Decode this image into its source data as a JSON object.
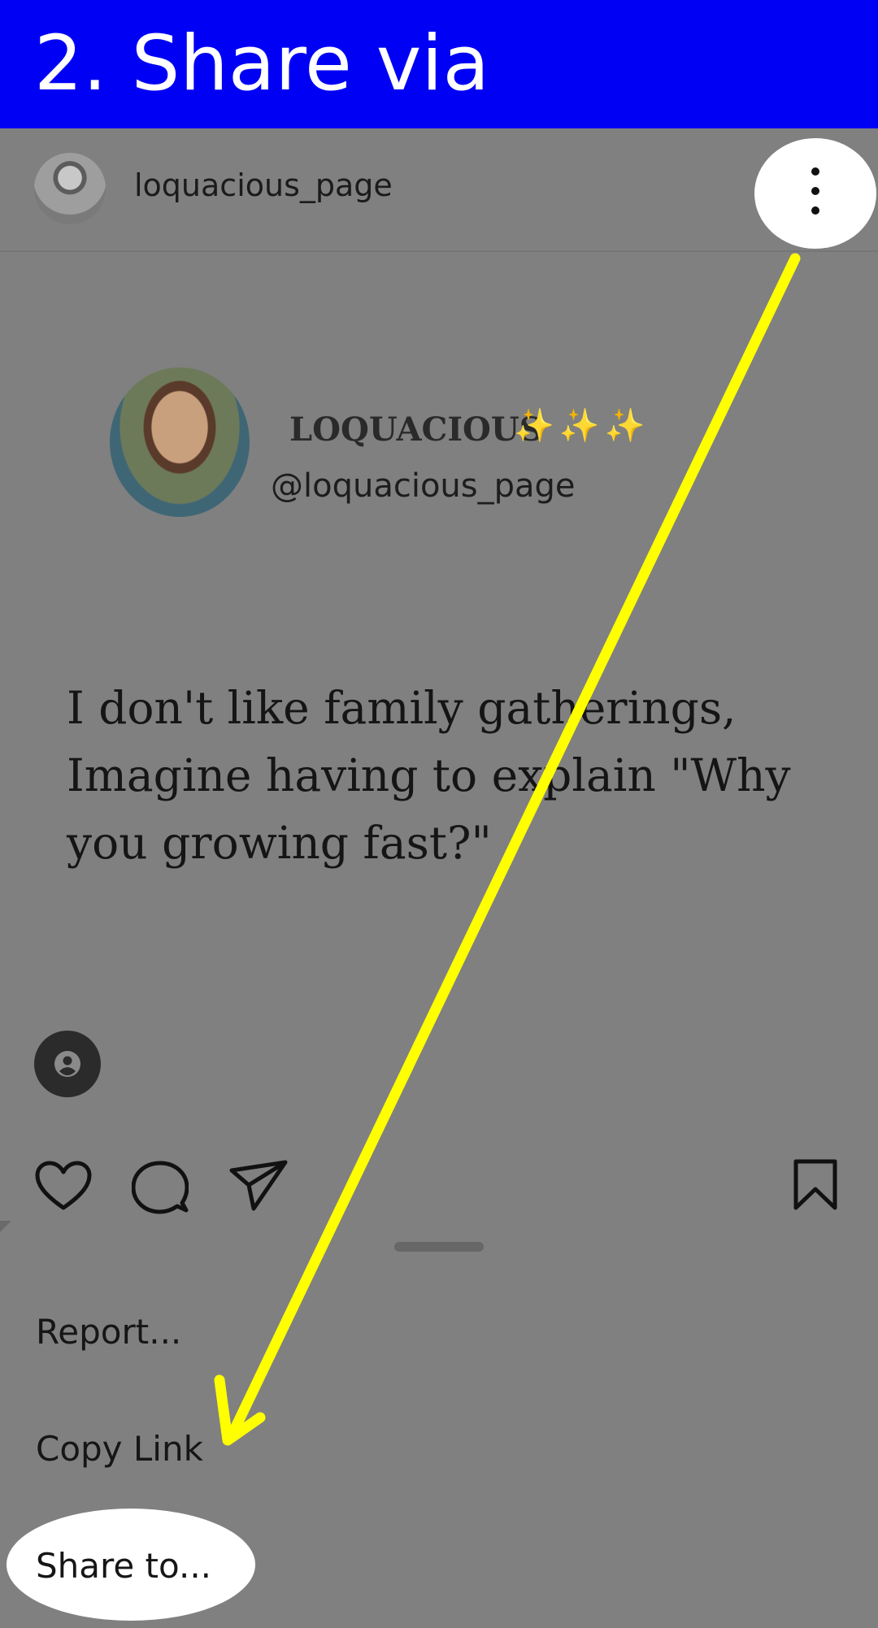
{
  "banner": {
    "title": "2. Share via",
    "color": "#0000F5"
  },
  "header": {
    "username": "loquacious_page"
  },
  "post": {
    "display_name": "LOQUACIOUS",
    "sparkles": "✨✨✨",
    "handle": "@loquacious_page",
    "quote_line1": "I don't like family gatherings,",
    "quote_line2": "Imagine having to explain \"Why",
    "quote_line3": "you growing fast?\""
  },
  "actions": {
    "like": "heart-icon",
    "comment": "comment-icon",
    "share": "send-icon",
    "save": "bookmark-icon"
  },
  "sheet": {
    "items": [
      {
        "label": "Report..."
      },
      {
        "label": "Copy Link"
      },
      {
        "label": "Share to..."
      }
    ]
  },
  "annotation": {
    "arrow_color": "#FFFF00",
    "highlight_color": "#FFFFFF"
  }
}
